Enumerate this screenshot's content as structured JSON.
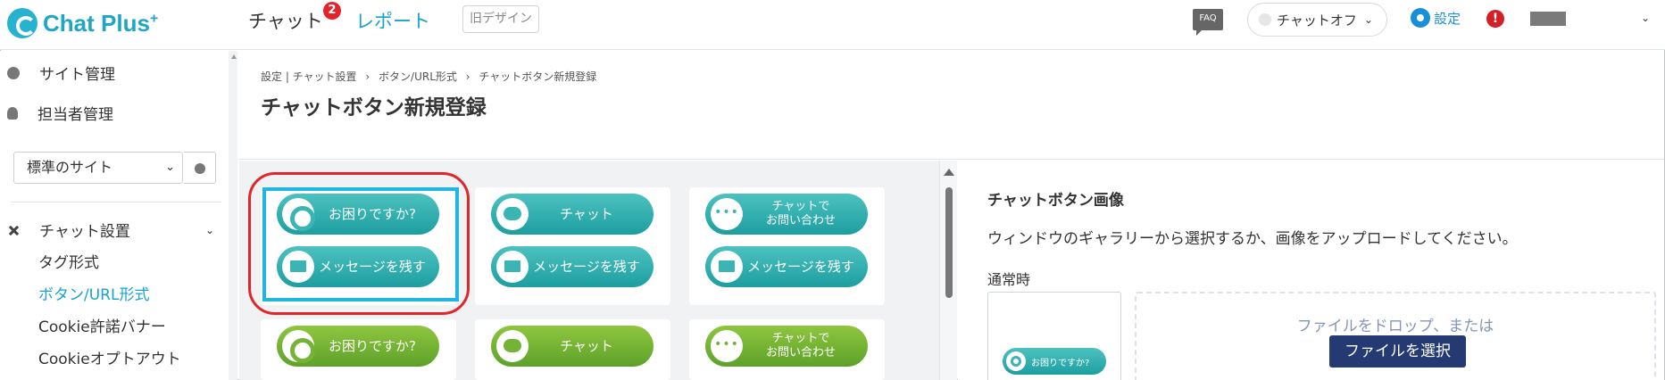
{
  "header": {
    "logo_text": "Chat Plus",
    "logo_sup": "+",
    "nav_chat": "チャット",
    "chat_badge": "2",
    "nav_report": "レポート",
    "old_design": "旧デザイン",
    "faq": "FAQ",
    "chat_status": "チャットオフ",
    "settings": "設定",
    "alert": "!"
  },
  "sidebar": {
    "items": [
      {
        "label": "サイト管理",
        "icon": "gear-icon"
      },
      {
        "label": "担当者管理",
        "icon": "person-icon"
      }
    ],
    "site_select": "標準のサイト",
    "section_label": "チャット設置",
    "sub_items": [
      {
        "label": "タグ形式",
        "active": false
      },
      {
        "label": "ボタン/URL形式",
        "active": true
      },
      {
        "label": "Cookie許諾バナー",
        "active": false
      },
      {
        "label": "Cookieオプトアウト",
        "active": false
      }
    ]
  },
  "breadcrumb": {
    "part1": "設定 | チャット設置",
    "sep1": "›",
    "part2": "ボタン/URL形式",
    "sep2": "›",
    "part3": "チャットボタン新規登録"
  },
  "page_title": "チャットボタン新規登録",
  "preview": {
    "row1": [
      {
        "top": "お困りですか?",
        "bottom": "メッセージを残す",
        "top_icon": "gear-icon"
      },
      {
        "top": "チャット",
        "bottom": "メッセージを残す",
        "top_icon": "chat-bubble-icon"
      },
      {
        "top": "チャットで\nお問い合わせ",
        "bottom": "メッセージを残す",
        "top_icon": "dots-icon"
      }
    ],
    "row2": [
      {
        "top": "お困りですか?",
        "top_icon": "gear-icon"
      },
      {
        "top": "チャット",
        "top_icon": "chat-bubble-icon"
      },
      {
        "top": "チャットで\nお問い合わせ",
        "top_icon": "dots-icon"
      }
    ],
    "colors": {
      "teal": "#2aacac",
      "green": "#6fb134",
      "selected": "#1fb6e2",
      "highlight": "#e0262b"
    }
  },
  "right_panel": {
    "title": "チャットボタン画像",
    "description": "ウィンドウのギャラリーから選択するか、画像をアップロードしてください。",
    "normal_label": "通常時",
    "thumb_label": "お困りですか?",
    "drop_text": "ファイルをドロップ、または",
    "file_button": "ファイルを選択"
  }
}
